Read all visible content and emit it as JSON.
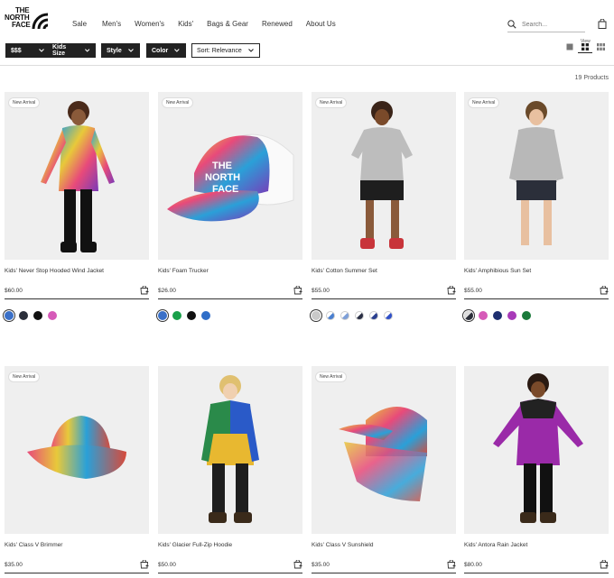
{
  "brand": {
    "logo_line1": "THE",
    "logo_line2": "NORTH",
    "logo_line3": "FACE"
  },
  "nav": [
    {
      "label": "Sale"
    },
    {
      "label": "Men's"
    },
    {
      "label": "Women's"
    },
    {
      "label": "Kids'"
    },
    {
      "label": "Bags & Gear"
    },
    {
      "label": "Renewed"
    },
    {
      "label": "About Us"
    }
  ],
  "search": {
    "placeholder": "Search..."
  },
  "filters": {
    "price": "$$$",
    "kids_size": "Kids Size",
    "style": "Style",
    "color": "Color",
    "sort": "Sort: Relevance",
    "view_label": "View"
  },
  "results": {
    "count_text": "19 Products"
  },
  "colors": {
    "accent": "#222222",
    "badge_border": "#dddddd",
    "image_bg": "#efefef"
  },
  "products": [
    {
      "badge": "New Arrival",
      "name": "Kids' Never Stop Hooded Wind Jacket",
      "price": "$60.00",
      "swatches": [
        "#3a70c8",
        "#2b2f3a",
        "#111111",
        "#d65ab8"
      ]
    },
    {
      "badge": "New Arrival",
      "name": "Kids' Foam Trucker",
      "price": "$26.00",
      "swatches": [
        "#3a70c8",
        "#19a04a",
        "#111111",
        "#2f6ec8"
      ]
    },
    {
      "badge": "New Arrival",
      "name": "Kids' Cotton Summer Set",
      "price": "$55.00",
      "swatches": [
        "#c9c9c9",
        "#4a7fd0",
        "#7d9fd8",
        "#2a2f45",
        "#2a3f8f",
        "#3050c8"
      ]
    },
    {
      "badge": "New Arrival",
      "name": "Kids' Amphibious Sun Set",
      "price": "$55.00",
      "swatches": [
        "#2b2f3a",
        "#d65ab8",
        "#1e2f70",
        "#a83ab8",
        "#1a7a3a"
      ]
    },
    {
      "badge": "New Arrival",
      "name": "Kids' Class V Brimmer",
      "price": "$35.00",
      "swatches": []
    },
    {
      "badge": "",
      "name": "Kids' Glacier Full-Zip Hoodie",
      "price": "$50.00",
      "swatches": []
    },
    {
      "badge": "New Arrival",
      "name": "Kids' Class V Sunshield",
      "price": "$35.00",
      "swatches": []
    },
    {
      "badge": "",
      "name": "Kids' Antora Rain Jacket",
      "price": "$80.00",
      "swatches": []
    }
  ]
}
